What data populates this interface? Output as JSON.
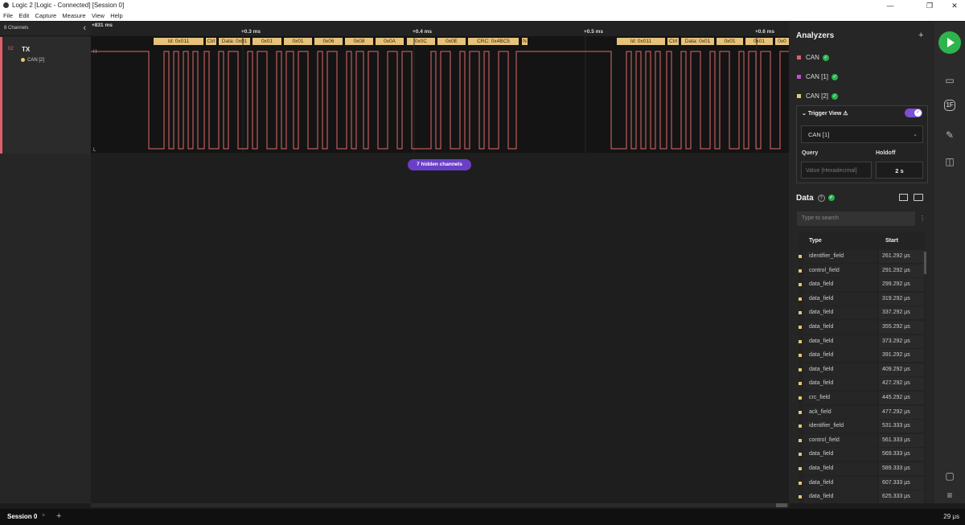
{
  "window": {
    "title": "Logic 2 [Logic - Connected] [Session 0]",
    "minimize": "—",
    "restore": "❐",
    "close": "✕"
  },
  "menu": [
    "File",
    "Edit",
    "Capture",
    "Measure",
    "View",
    "Help"
  ],
  "channels_panel": {
    "header": "8 Channels",
    "collapse": "‹"
  },
  "channel": {
    "number": "02",
    "name": "TX",
    "analyzer": "CAN [2]",
    "high": "H",
    "low": "L"
  },
  "timeline": {
    "start_label": "+831 ms",
    "ticks": [
      "+0.3 ms",
      "+0.4 ms",
      "+0.5 ms",
      "+0.6 ms"
    ],
    "frames": [
      "Id: 0x011",
      "Ctrl",
      "Data: 0x01",
      "0x01",
      "0x01",
      "0x06",
      "0x08",
      "0x0A",
      "0x0C",
      "0x0E",
      "CRC: 0x4BC5",
      "N",
      "Id: 0x011",
      "Ctrl",
      "Data: 0x01",
      "0x01",
      "0x01",
      "0x0"
    ],
    "hidden_channels": "7 hidden channels"
  },
  "analyzers": {
    "title": "Analyzers",
    "add": "+",
    "items": [
      {
        "label": "CAN",
        "color": "#e0606b"
      },
      {
        "label": "CAN [1]",
        "color": "#c04fd0"
      },
      {
        "label": "CAN [2]",
        "color": "#e6c76b"
      }
    ]
  },
  "trigger": {
    "title": "Trigger View ⚠",
    "selected": "CAN [1]",
    "query_label": "Query",
    "query_placeholder": "Value [Hexadecimal]",
    "holdoff_label": "Holdoff",
    "holdoff_value": "2 s"
  },
  "data": {
    "title": "Data",
    "search_placeholder": "Type to search",
    "columns": [
      "Type",
      "Start"
    ],
    "rows": [
      [
        "identifier_field",
        "261.292 μs"
      ],
      [
        "control_field",
        "291.292 μs"
      ],
      [
        "data_field",
        "299.292 μs"
      ],
      [
        "data_field",
        "319.292 μs"
      ],
      [
        "data_field",
        "337.292 μs"
      ],
      [
        "data_field",
        "355.292 μs"
      ],
      [
        "data_field",
        "373.292 μs"
      ],
      [
        "data_field",
        "391.292 μs"
      ],
      [
        "data_field",
        "409.292 μs"
      ],
      [
        "data_field",
        "427.292 μs"
      ],
      [
        "crc_field",
        "445.292 μs"
      ],
      [
        "ack_field",
        "477.292 μs"
      ],
      [
        "identifier_field",
        "531.333 μs"
      ],
      [
        "control_field",
        "561.333 μs"
      ],
      [
        "data_field",
        "569.333 μs"
      ],
      [
        "data_field",
        "589.333 μs"
      ],
      [
        "data_field",
        "607.333 μs"
      ],
      [
        "data_field",
        "625.333 μs"
      ]
    ]
  },
  "bottom": {
    "session": "Session 0",
    "close": "×",
    "add": "+",
    "rate": "29 μs"
  },
  "colors": {
    "signal": "#e06a6a",
    "frame": "#e6c27a",
    "accent": "#6a3fc7",
    "run": "#2fb34c"
  }
}
